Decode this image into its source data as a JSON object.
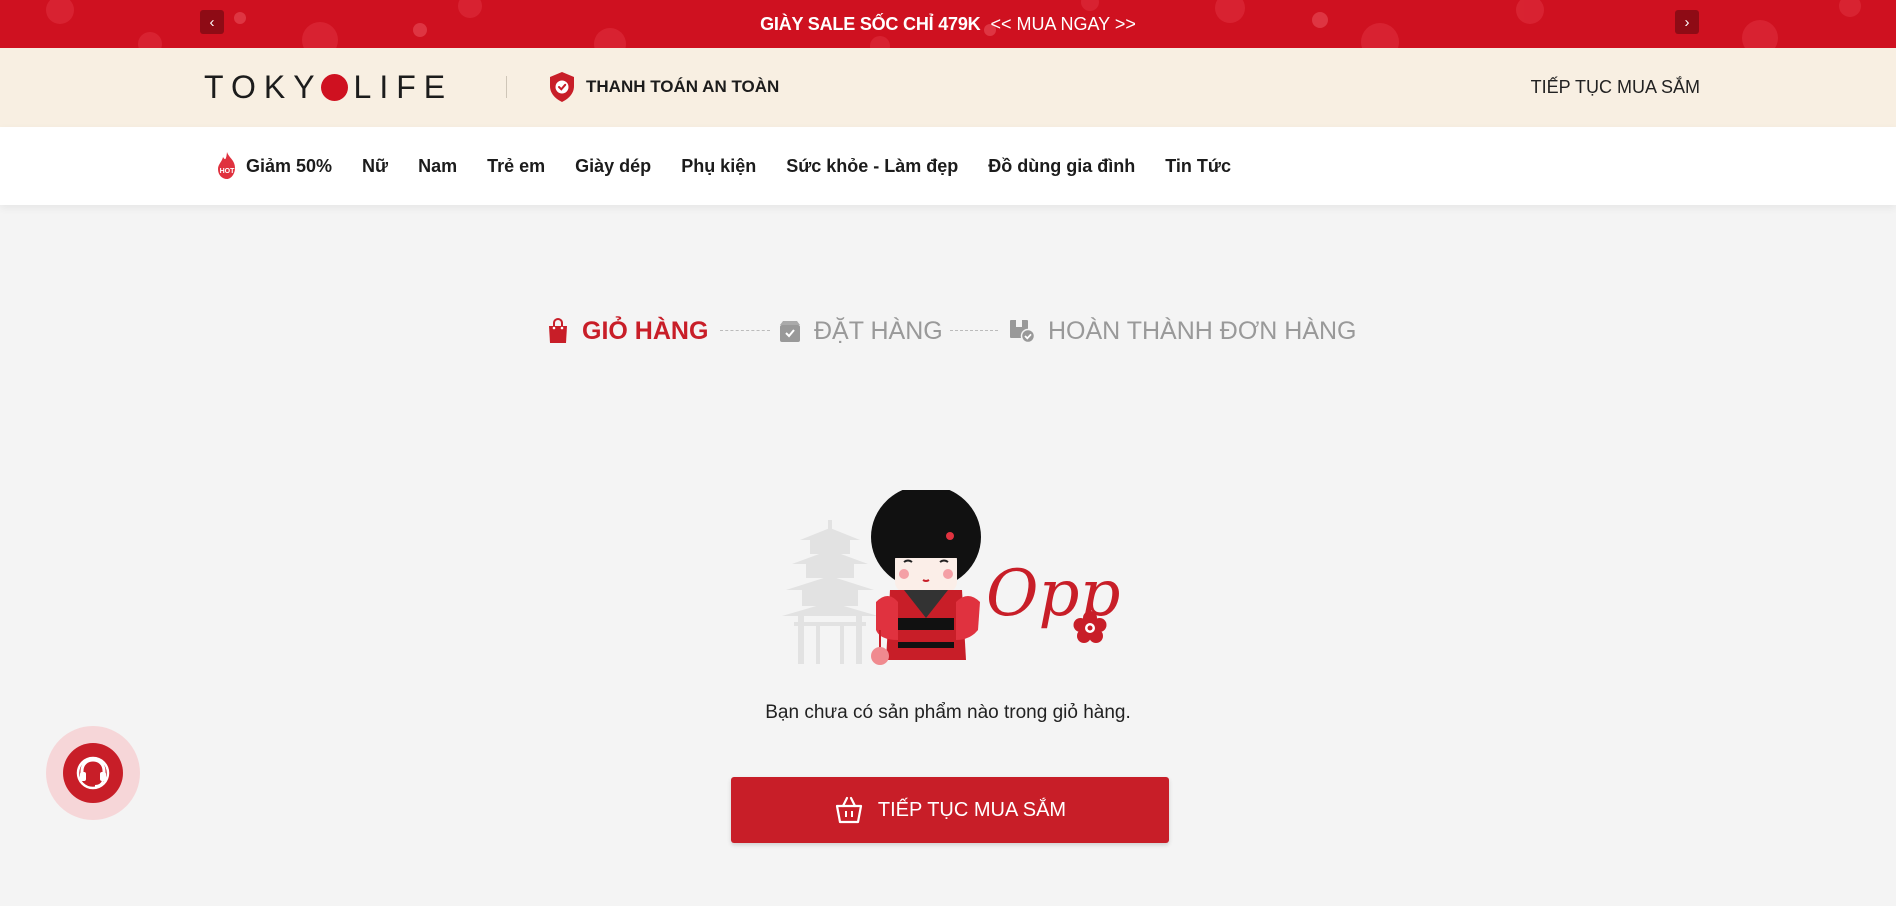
{
  "promo": {
    "headline": "GIÀY SALE SỐC CHỈ 479K",
    "cta": "<< MUA NGAY >>",
    "prev_icon": "‹",
    "next_icon": "›",
    "bg_color": "#cf1120"
  },
  "header": {
    "logo_left": "TOKY",
    "logo_right": "LIFE",
    "secure_label": "THANH TOÁN AN TOÀN",
    "continue_label": "TIẾP TỤC MUA SẮM"
  },
  "nav": {
    "hot_badge": "HOT",
    "items": [
      "Giảm 50%",
      "Nữ",
      "Nam",
      "Trẻ em",
      "Giày dép",
      "Phụ kiện",
      "Sức khỏe - Làm đẹp",
      "Đồ dùng gia đình",
      "Tin Tức"
    ]
  },
  "steps": [
    {
      "label": "GIỎ HÀNG",
      "icon": "shopping-bag-icon",
      "state": "active"
    },
    {
      "label": "ĐẶT HÀNG",
      "icon": "box-icon",
      "state": "inactive"
    },
    {
      "label": "HOÀN THÀNH ĐƠN HÀNG",
      "icon": "package-check-icon",
      "state": "inactive"
    }
  ],
  "empty": {
    "oops_text": "Opp!",
    "message": "Bạn chưa có sản phẩm nào trong giỏ hàng.",
    "button_label": "TIẾP TỤC MUA SẮM",
    "button_icon": "basket-icon"
  },
  "colors": {
    "brand_red": "#c81e28",
    "header_bg": "#f8efe2",
    "page_bg": "#f4f4f4"
  }
}
